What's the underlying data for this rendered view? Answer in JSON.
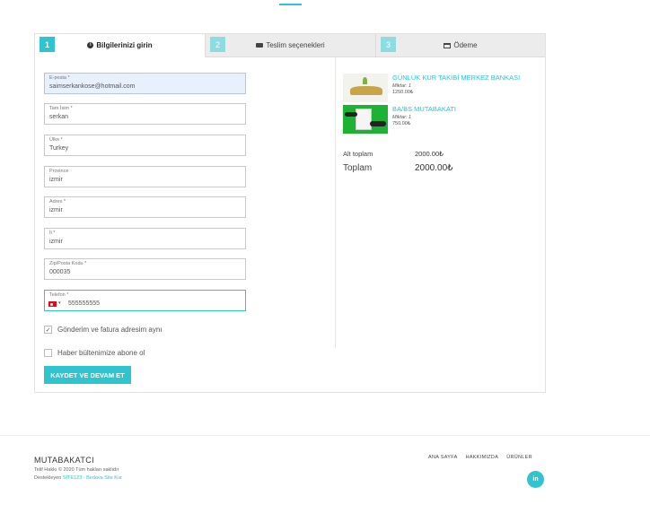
{
  "tabs": [
    {
      "num": "1",
      "label": "Bilgilerinizi girin",
      "icon": "info-circle-icon",
      "active": true
    },
    {
      "num": "2",
      "label": "Teslim seçenekleri",
      "icon": "truck-icon",
      "active": false
    },
    {
      "num": "3",
      "label": "Ödeme",
      "icon": "credit-card-icon",
      "active": false
    }
  ],
  "form": {
    "email": {
      "label": "E-posta *",
      "value": "saimserkankose@hotmail.com"
    },
    "full_name": {
      "label": "Tam İsim *",
      "value": "serkan"
    },
    "country": {
      "label": "Ülke *",
      "value": "Turkey"
    },
    "province": {
      "label": "Province",
      "value": "izmir"
    },
    "address": {
      "label": "Adres *",
      "value": "izmir"
    },
    "city": {
      "label": "İl *",
      "value": "izmir"
    },
    "zip": {
      "label": "Zip/Posta Kodu *",
      "value": "000035"
    },
    "phone": {
      "label": "Telefon *",
      "value": "555555555",
      "flag": "turkey-flag-icon"
    },
    "same_address": {
      "label": "Gönderim ve fatura adresim aynı",
      "checked": true
    },
    "newsletter": {
      "label": "Haber bültenimize abone ol",
      "checked": false
    },
    "save_label": "KAYDET VE DEVAM ET"
  },
  "cart": {
    "items": [
      {
        "name": "GÜNLÜK KUR TAKİBİ MERKEZ BANKASI",
        "qty": "Miktar: 1",
        "price": "1250.00₺"
      },
      {
        "name": "BA/BS MUTABAKATI",
        "qty": "Miktar: 1",
        "price": "750.00₺"
      }
    ],
    "subtotal_label": "Alt toplam",
    "subtotal_value": "2000.00₺",
    "total_label": "Toplam",
    "total_value": "2000.00₺"
  },
  "footer": {
    "brand": "MUTABAKATCI",
    "copyright": "Telif Hakkı © 2020 Tüm hakları saklıdır",
    "powered_prefix": "Destekleyen ",
    "powered_link": "SITE123 - Bedava Site Kur",
    "nav": [
      "ANA SAYFA",
      "HAKKIMIZDA",
      "ÜRÜNLER"
    ],
    "social": "in"
  },
  "colors": {
    "accent": "#2ec4d0"
  }
}
